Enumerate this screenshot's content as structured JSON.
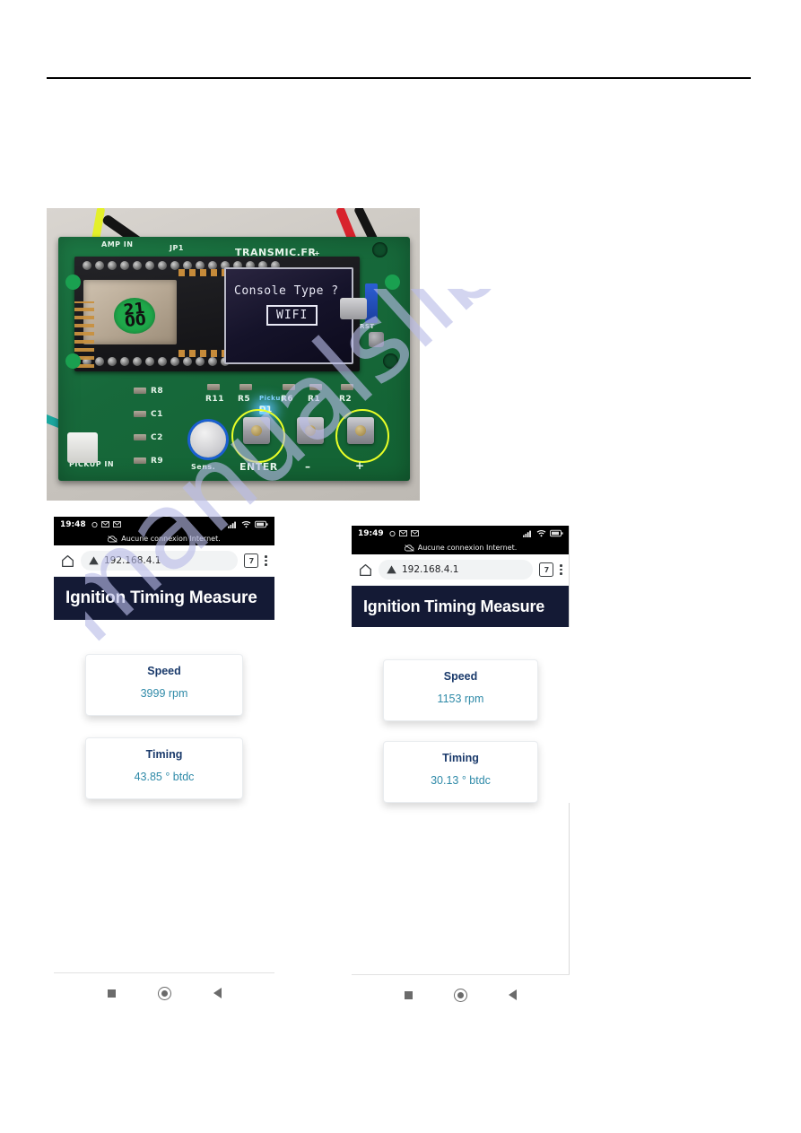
{
  "watermark": {
    "text": "manualslib.com"
  },
  "pcb": {
    "brand": "TRANSMIC.FR",
    "silk": {
      "amp_in": "AMP IN",
      "jp1": "JP1",
      "pickup_in": "PICKUP IN",
      "sens": "Sens.",
      "enter": "ENTER",
      "minus": "–",
      "plus": "+",
      "pickup": "Pickup",
      "rst": "RST",
      "plus_pwr": "+",
      "r8": "R8",
      "c1": "C1",
      "c2": "C2",
      "r9": "R9",
      "r11": "R11",
      "r5": "R5",
      "d1": "D1",
      "r6": "R6",
      "r1": "R1",
      "r2": "R2"
    },
    "module_mark": "21\n00",
    "oled": {
      "prompt": "Console Type ?",
      "selection": "WIFI"
    }
  },
  "phone_left": {
    "status": {
      "time": "19:48",
      "note": "Aucune connexion Internet."
    },
    "browser": {
      "url": "192.168.4.1",
      "tab_count": "7"
    },
    "site": {
      "title": "Ignition Timing Measure"
    },
    "cards": [
      {
        "title": "Speed",
        "value": "3999 rpm"
      },
      {
        "title": "Timing",
        "value": "43.85 ° btdc"
      }
    ]
  },
  "phone_right": {
    "status": {
      "time": "19:49",
      "note": "Aucune connexion Internet."
    },
    "browser": {
      "url": "192.168.4.1",
      "tab_count": "7"
    },
    "site": {
      "title": "Ignition Timing Measure"
    },
    "cards": [
      {
        "title": "Speed",
        "value": "1153 rpm"
      },
      {
        "title": "Timing",
        "value": "30.13 ° btdc"
      }
    ]
  },
  "colors": {
    "header_bg": "#141a35",
    "card_title": "#1a3a6b",
    "card_value": "#2f8aa8",
    "pcb_green": "#17693b",
    "highlight": "#e9ff27"
  }
}
